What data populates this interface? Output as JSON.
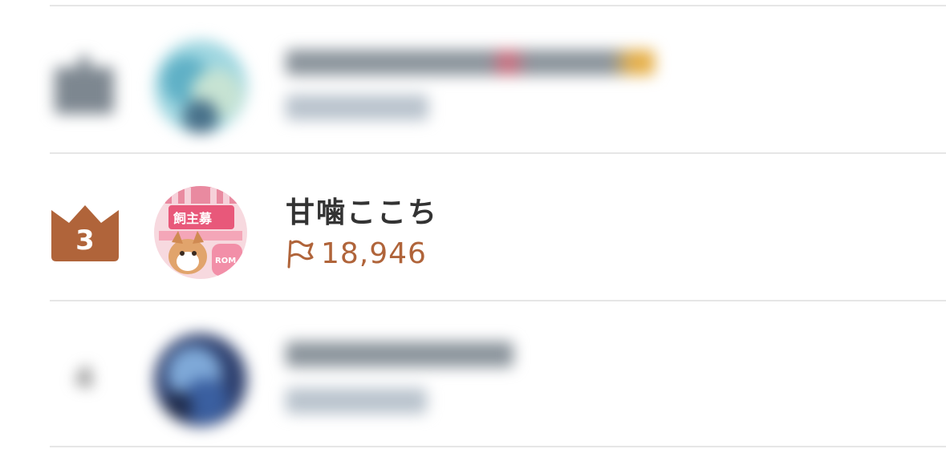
{
  "rows": [
    {
      "rank": "",
      "username": "",
      "count": "",
      "blurred": true
    },
    {
      "rank": "3",
      "username": "甘噛ここち",
      "count": "18,946",
      "blurred": false,
      "crown_color": "#b0643a",
      "count_color": "#b0643a"
    },
    {
      "rank": "4",
      "username": "",
      "count": "",
      "blurred": true
    }
  ],
  "icons": {
    "crown": "crown-icon",
    "flag": "flag-icon"
  }
}
